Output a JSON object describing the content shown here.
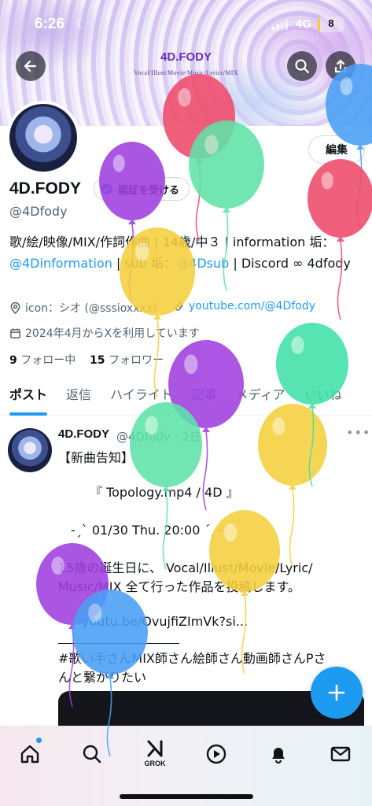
{
  "status_bar": {
    "time": "6:26",
    "network": "4G",
    "battery": "8",
    "battery_level": 0.08
  },
  "header": {
    "brand": "4D.FODY",
    "subtitle": "Vocal/Illust/Movie/Music/Lyrics/MIX"
  },
  "profile": {
    "edit_label": "編集",
    "display_name": "4D.FODY",
    "verify_label": "認証を受ける",
    "handle": "@4Dfody",
    "bio_line1": "歌/絵/映像/MIX/作詞作曲 | 14歳/中３ | information 垢：",
    "bio_link1": "@4Dinformation",
    "bio_mid": " | sub 垢：",
    "bio_link2": "@4Dsub",
    "bio_end": " | Discord ∞ 4dfody",
    "icon_credit": "icon：シオ (@sssioxxxx)",
    "website": "youtube.com/@4Dfody",
    "joined": "2024年4月からXを利用しています",
    "following_count": "9",
    "following_label": "フォロー中",
    "followers_count": "15",
    "followers_label": "フォロワー"
  },
  "tabs": [
    "ポスト",
    "返信",
    "ハイライト",
    "記事",
    "メディア",
    "いいね"
  ],
  "tweet": {
    "author": "4D.FODY",
    "handle_time": "@4Dfody · 2日",
    "lines": [
      "【新曲告知】",
      "　　　『 Topology.mp4 / 4D 』",
      "　-ˏˋ 01/30 Thu. 20:00 ˊˎ-",
      "15歳の誕生日に、 Vocal/Illust/Movie/Lyric/",
      "Music/MIX 全て行った作品を投稿します。"
    ],
    "link": "youtu.be/OvujfiZImVk?si...",
    "hashtag_line1": "#歌い手さんMIX師さん絵師さん動画師さんPさ",
    "hashtag_line2": "んと繋がりたい"
  },
  "bottom_nav": {
    "grok_label": "GROK"
  },
  "balloon_colors": [
    "#ef4b6a",
    "#4a9ff5",
    "#5fe3a8",
    "#9f3fe0",
    "#f5cf3d",
    "#ef4b6a",
    "#f5cf3d",
    "#9f3fe0",
    "#42e0a9",
    "#f5cf3d",
    "#5fe3a8",
    "#f5cf3d",
    "#9f3fe0",
    "#4a9ff5"
  ]
}
